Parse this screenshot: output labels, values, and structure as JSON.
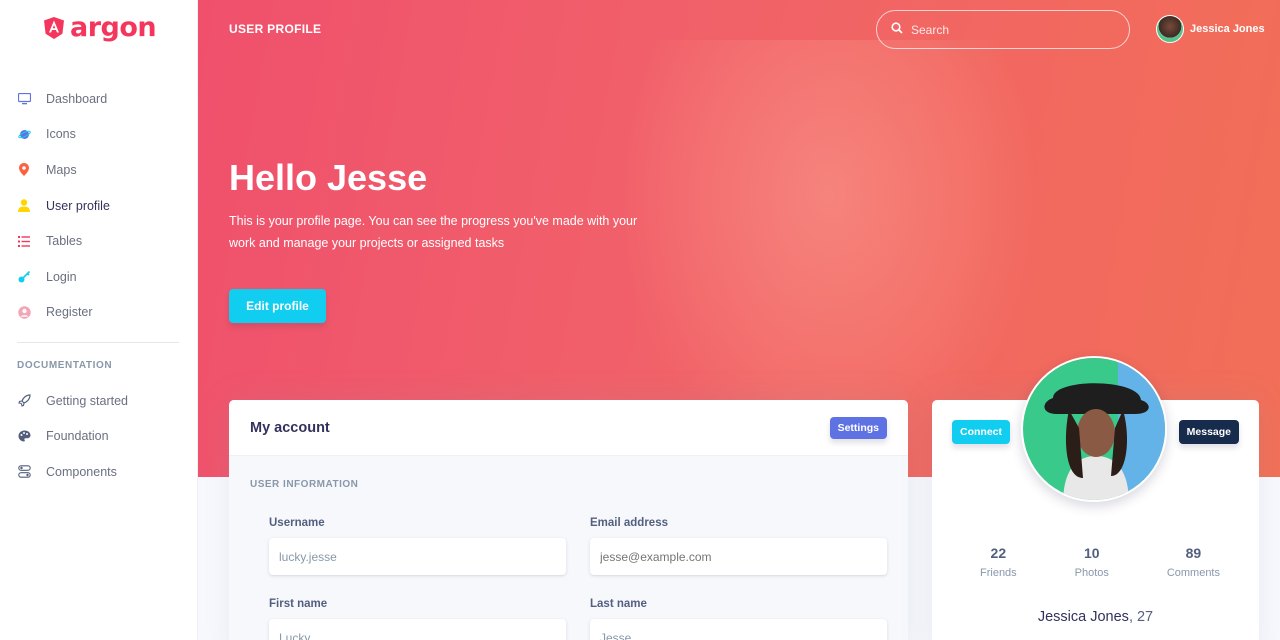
{
  "brand": {
    "name": "argon"
  },
  "sidebar": {
    "items": [
      {
        "label": "Dashboard",
        "icon": "tv-icon",
        "color": "#5e72e4"
      },
      {
        "label": "Icons",
        "icon": "planet-icon",
        "color": "#5e72e4"
      },
      {
        "label": "Maps",
        "icon": "pin-icon",
        "color": "#fb6340"
      },
      {
        "label": "User profile",
        "icon": "user-icon",
        "color": "#ffd600",
        "active": true
      },
      {
        "label": "Tables",
        "icon": "bullet-list-icon",
        "color": "#f5365c"
      },
      {
        "label": "Login",
        "icon": "key-icon",
        "color": "#11cdef"
      },
      {
        "label": "Register",
        "icon": "circle-user-icon",
        "color": "#f3a4b5"
      }
    ],
    "documentation_heading": "DOCUMENTATION",
    "doc_items": [
      {
        "label": "Getting started",
        "icon": "spaceship-icon"
      },
      {
        "label": "Foundation",
        "icon": "palette-icon"
      },
      {
        "label": "Components",
        "icon": "ui-icon"
      }
    ]
  },
  "topbar": {
    "title": "USER PROFILE",
    "search_placeholder": "Search",
    "user_name": "Jessica Jones"
  },
  "hero": {
    "greeting": "Hello Jesse",
    "intro": "This is your profile page. You can see the progress you've made with your work and manage your projects or assigned tasks",
    "edit_button": "Edit profile"
  },
  "account": {
    "title": "My account",
    "settings_button": "Settings",
    "section": "USER INFORMATION",
    "fields": {
      "username": {
        "label": "Username",
        "value": "lucky.jesse"
      },
      "email": {
        "label": "Email address",
        "placeholder": "jesse@example.com"
      },
      "first_name": {
        "label": "First name",
        "value": "Lucky"
      },
      "last_name": {
        "label": "Last name",
        "value": "Jesse"
      }
    }
  },
  "profile": {
    "connect_button": "Connect",
    "message_button": "Message",
    "stats": [
      {
        "value": "22",
        "label": "Friends"
      },
      {
        "value": "10",
        "label": "Photos"
      },
      {
        "value": "89",
        "label": "Comments"
      }
    ],
    "name": "Jessica Jones",
    "age": ", 27"
  },
  "colors": {
    "primary": "#5e72e4",
    "info": "#11cdef",
    "danger": "#f5365c",
    "dark": "#172b4d"
  }
}
